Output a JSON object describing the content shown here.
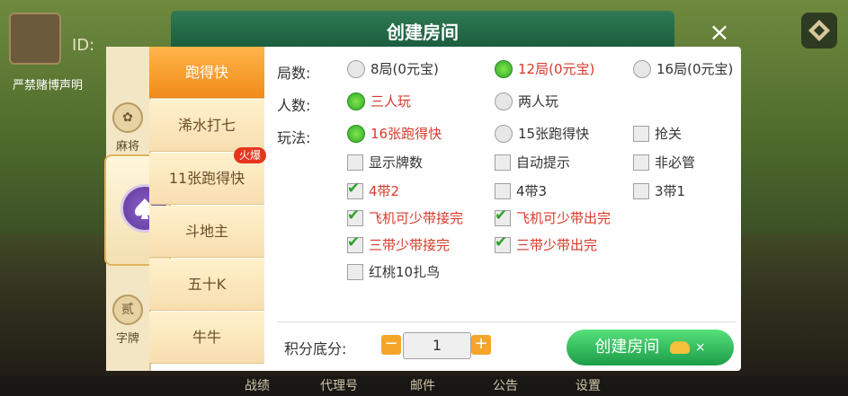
{
  "background": {
    "profile": {
      "id_label": "ID:",
      "notice": "严禁赌博声明"
    },
    "bottom_nav": [
      "战绩",
      "代理号",
      "邮件",
      "公告",
      "设置"
    ]
  },
  "dialog": {
    "title": "创建房间",
    "close_label": "×",
    "categories": [
      {
        "label": "麻将",
        "icon": "mahjong-icon"
      },
      {
        "label": "",
        "icon": "spade-chip-icon"
      },
      {
        "label": "字牌",
        "icon": "zipai-icon",
        "icon_text": "贰"
      }
    ],
    "games": [
      {
        "label": "跑得快",
        "active": true
      },
      {
        "label": "浠水打七"
      },
      {
        "label": "11张跑得快",
        "badge": "火爆"
      },
      {
        "label": "斗地主"
      },
      {
        "label": "五十K"
      },
      {
        "label": "牛牛"
      }
    ],
    "options": {
      "rounds": {
        "label": "局数:",
        "choices": [
          "8局(0元宝)",
          "12局(0元宝)",
          "16局(0元宝)"
        ],
        "selected": 1
      },
      "players": {
        "label": "人数:",
        "choices": [
          "三人玩",
          "两人玩"
        ],
        "selected": 0
      },
      "play": {
        "label": "玩法:",
        "radio": [
          "16张跑得快",
          "15张跑得快"
        ],
        "checks": [
          {
            "text": "抢关",
            "on": false
          },
          {
            "text": "显示牌数",
            "on": false
          },
          {
            "text": "自动提示",
            "on": false
          },
          {
            "text": "非必管",
            "on": false
          },
          {
            "text": "4带2",
            "on": true
          },
          {
            "text": "4带3",
            "on": false
          },
          {
            "text": "3带1",
            "on": false
          },
          {
            "text": "飞机可少带接完",
            "on": true
          },
          {
            "text": "飞机可少带出完",
            "on": true
          },
          {
            "text": "三带少带接完",
            "on": true
          },
          {
            "text": "三带少带出完",
            "on": true
          },
          {
            "text": "红桃10扎鸟",
            "on": false
          }
        ]
      }
    },
    "score": {
      "label": "积分底分:",
      "value": "1"
    },
    "create_button": {
      "label": "创建房间",
      "cost": "×"
    },
    "colors": {
      "accent": "#f08a1a",
      "selected_text": "#d63a2a",
      "green": "#2fa72a"
    }
  }
}
